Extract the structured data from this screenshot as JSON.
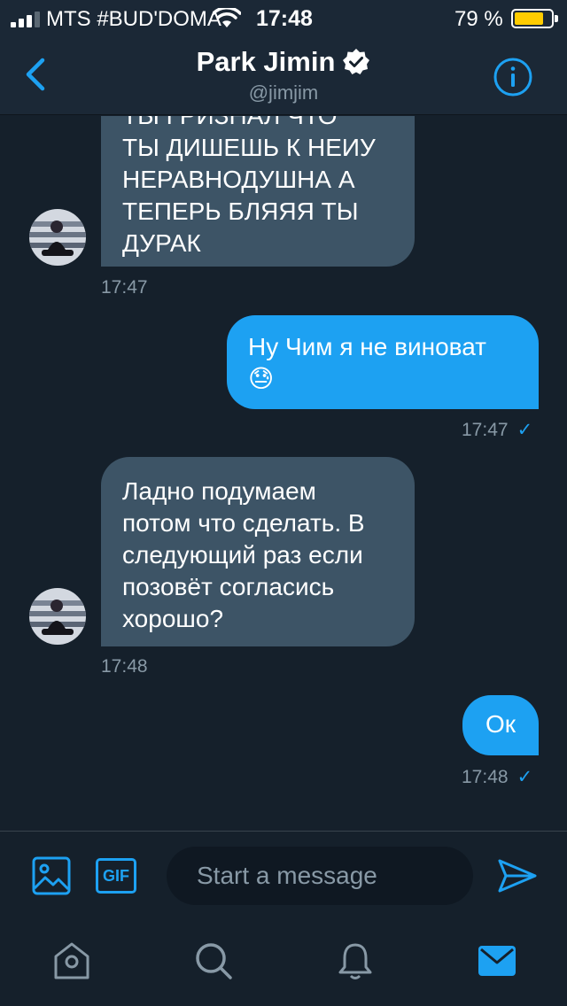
{
  "status": {
    "carrier": "MTS #BUD'DOMA",
    "time": "17:48",
    "battery": "79 %",
    "battery_level": 0.79,
    "battery_color": "#ffcc00"
  },
  "header": {
    "name": "Park Jimin",
    "handle": "@jimjim"
  },
  "messages": [
    {
      "direction": "in",
      "lines": [
        "ТЫ ГРИЗНАЛ ЧТО",
        "ТЫ ДИШЕШЬ К НЕИУ",
        "НЕРАВНОДУШНА А",
        "ТЕПЕРЬ БЛЯЯЯ ТЫ",
        "ДУРАК"
      ],
      "time": "17:47"
    },
    {
      "direction": "out",
      "lines": [
        "Ну Чим я не виноват",
        "😓"
      ],
      "time": "17:47",
      "status": "✓"
    },
    {
      "direction": "in",
      "lines": [
        "Ладно подумаем",
        "потом что сделать. В",
        "следующий раз если",
        "позовёт согласись",
        "хорошо?"
      ],
      "time": "17:48"
    },
    {
      "direction": "out",
      "lines": [
        "Ок"
      ],
      "time": "17:48",
      "status": "✓"
    }
  ],
  "composer": {
    "placeholder": "Start a message",
    "gif_label": "GIF"
  },
  "tabs": [
    {
      "icon": "home-icon",
      "active": false
    },
    {
      "icon": "search-icon",
      "active": false
    },
    {
      "icon": "notifications-icon",
      "active": false
    },
    {
      "icon": "messages-icon",
      "active": true
    }
  ],
  "colors": {
    "accent": "#1da1f2",
    "background": "#15202b",
    "incoming_bubble": "#3d5466",
    "muted": "#8899a6"
  }
}
